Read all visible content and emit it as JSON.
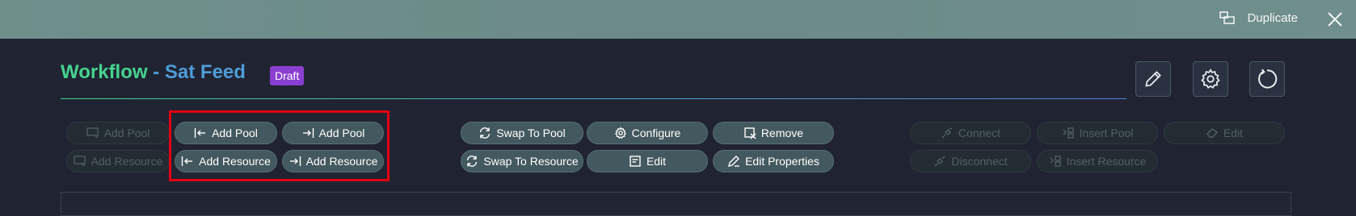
{
  "header": {
    "duplicate_label": "Duplicate",
    "icons": {
      "duplicate": "duplicate-icon",
      "close": "close-icon"
    }
  },
  "workflow": {
    "title_prefix": "Workflow",
    "title_name": "- Sat Feed",
    "status_badge": "Draft",
    "colors": {
      "prefix": "#45d391",
      "name": "#4f9cd8",
      "badge": "#8a3fd0",
      "highlight": "#e3000f"
    }
  },
  "actions": {
    "icons": [
      "pencil-icon",
      "gear-icon",
      "refresh-icon"
    ]
  },
  "toolbar": {
    "left_disabled": {
      "add_pool": "Add Pool",
      "add_resource": "Add Resource"
    },
    "highlighted": {
      "add_pool_left": "Add Pool",
      "add_pool_right": "Add Pool",
      "add_resource_left": "Add Resource",
      "add_resource_right": "Add Resource"
    },
    "middle": {
      "swap_to_pool": "Swap To Pool",
      "configure": "Configure",
      "remove": "Remove",
      "swap_to_resource": "Swap To Resource",
      "edit": "Edit",
      "edit_properties": "Edit Properties"
    },
    "right_disabled": {
      "connect": "Connect",
      "insert_pool": "Insert Pool",
      "edit": "Edit",
      "disconnect": "Disconnect",
      "insert_resource": "Insert Resource"
    }
  }
}
